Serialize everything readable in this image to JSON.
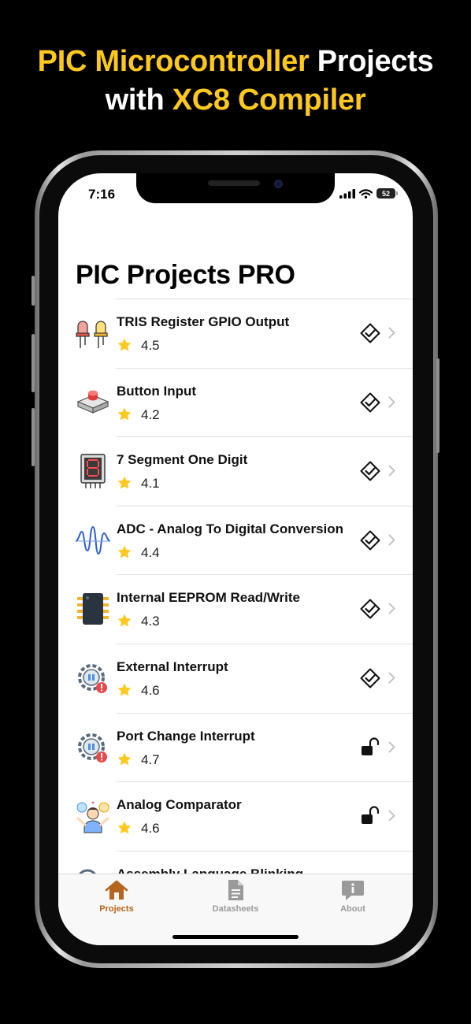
{
  "promo": {
    "headline_line1_part1": "PIC Microcontroller",
    "headline_line1_part2": "Projects",
    "headline_line2_part1": "with",
    "headline_line2_part2": "XC8 Compiler",
    "accent_color": "#ffc81e"
  },
  "status_bar": {
    "time": "7:16",
    "battery": "52"
  },
  "page": {
    "title": "PIC Projects PRO"
  },
  "projects": [
    {
      "title": "TRIS Register GPIO Output",
      "rating": "4.5",
      "icon": "led-icon",
      "status": "completed"
    },
    {
      "title": "Button Input",
      "rating": "4.2",
      "icon": "push-button-icon",
      "status": "completed"
    },
    {
      "title": "7 Segment One Digit",
      "rating": "4.1",
      "icon": "seven-segment-icon",
      "status": "completed"
    },
    {
      "title": "ADC - Analog To Digital Conversion",
      "rating": "4.4",
      "icon": "analog-wave-icon",
      "status": "completed"
    },
    {
      "title": "Internal EEPROM Read/Write",
      "rating": "4.3",
      "icon": "chip-icon",
      "status": "completed"
    },
    {
      "title": "External Interrupt",
      "rating": "4.6",
      "icon": "interrupt-gear-icon",
      "status": "completed"
    },
    {
      "title": "Port Change Interrupt",
      "rating": "4.7",
      "icon": "interrupt-gear-icon",
      "status": "unlocked"
    },
    {
      "title": "Analog Comparator",
      "rating": "4.6",
      "icon": "comparator-person-icon",
      "status": "unlocked"
    },
    {
      "title": "Assembly Language Blinking",
      "rating": "",
      "icon": "partial-icon",
      "status": ""
    }
  ],
  "tabs": [
    {
      "label": "Projects",
      "icon": "house-icon",
      "active": true
    },
    {
      "label": "Datasheets",
      "icon": "document-icon",
      "active": false
    },
    {
      "label": "About",
      "icon": "info-bubble-icon",
      "active": false
    }
  ],
  "colors": {
    "tab_active": "#b5651d",
    "tab_inactive": "#9a9a9a",
    "star": "#ffc81e"
  }
}
